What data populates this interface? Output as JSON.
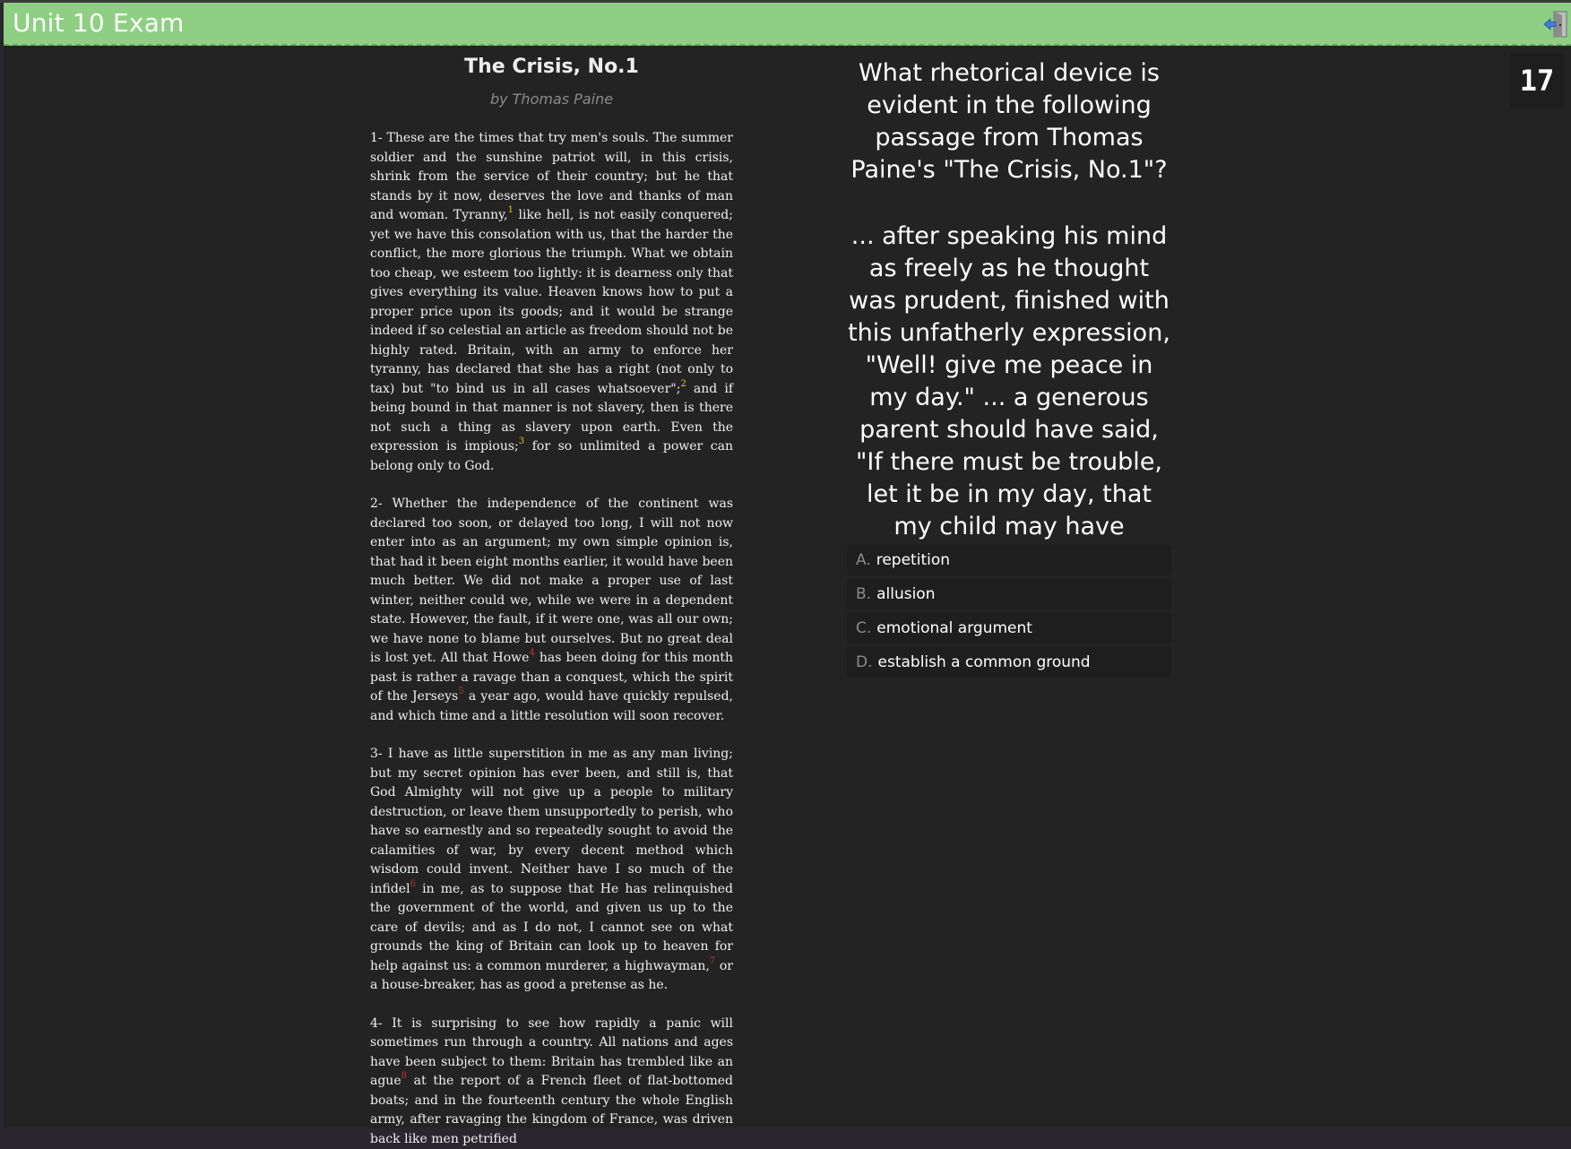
{
  "header": {
    "title": "Unit 10 Exam",
    "exit_icon": "exit-door-icon"
  },
  "counter": "17",
  "passage": {
    "title": "The Crisis, No.1",
    "author": "by Thomas Paine",
    "paragraphs": [
      [
        {
          "t": "1- These are the times that try men's souls. The summer soldier and the sunshine patriot will, in this crisis, shrink from the service of their country; but he that stands by it now, deserves the love and thanks of man and woman. Tyranny,"
        },
        {
          "fn": "1",
          "c": "y"
        },
        {
          "t": " like hell, is not easily conquered; yet we have this consolation with us, that the harder the conflict, the more glorious the triumph. What we obtain too cheap, we esteem too lightly: it is dearness only that gives everything its value. Heaven knows how to put a proper price upon its goods; and it would be strange indeed if so celestial an article as freedom should not be highly rated. Britain, with an army to enforce her tyranny, has declared that she has a right (not only to tax) but \"to bind us in all cases whatsoever\";"
        },
        {
          "fn": "2",
          "c": "y"
        },
        {
          "t": " and if being bound in that manner is not slavery, then is there not such a thing as slavery upon earth. Even the expression is impious;"
        },
        {
          "fn": "3",
          "c": "y"
        },
        {
          "t": " for so unlimited a power can belong only to God."
        }
      ],
      [
        {
          "t": "2- Whether the independence of the continent was declared too soon, or delayed too long, I will not now enter into as an argument; my own simple opinion is, that had it been eight months earlier, it would have been much better. We did not make a proper use of last winter, neither could we, while we were in a dependent state. However, the fault, if it were one, was all our own; we have none to blame but ourselves. But no great deal is lost yet. All that Howe"
        },
        {
          "fn": "4",
          "c": "r"
        },
        {
          "t": " has been doing for this month past is rather a ravage than a conquest, which the spirit of the Jerseys"
        },
        {
          "fn": "5",
          "c": "r"
        },
        {
          "t": " a year ago, would have quickly repulsed, and which time and a little resolution will soon recover."
        }
      ],
      [
        {
          "t": "3- I have as little superstition in me as any man living; but my secret opinion has ever been, and still is, that God Almighty will not give up a people to military destruction, or leave them unsupportedly to perish, who have so earnestly and so repeatedly sought to avoid the calamities of war, by every decent method which wisdom could invent. Neither have I so much of the infidel"
        },
        {
          "fn": "6",
          "c": "r"
        },
        {
          "t": " in me, as to suppose that He has relinquished the government of the world, and given us up to the care of devils; and as I do not, I cannot see on what grounds the king of Britain can look up to heaven for help against us: a common murderer, a highwayman,"
        },
        {
          "fn": "7",
          "c": "r"
        },
        {
          "t": " or a house-breaker, has as good a pretense as he."
        }
      ],
      [
        {
          "t": "4- It is surprising to see how rapidly a panic will sometimes run through a country. All nations and ages have been subject to them: Britain has trembled like an ague"
        },
        {
          "fn": "8",
          "c": "r"
        },
        {
          "t": " at the report of a French fleet of flat-bottomed boats; and in the fourteenth century the whole English army, after ravaging the kingdom of France, was driven back like men petrified"
        }
      ]
    ]
  },
  "question": {
    "text": "What rhetorical device is evident in the following passage from Thomas Paine's \"The Crisis, No.1\"?",
    "quote": "... after speaking his mind as freely as he thought was prudent, finished with this unfatherly expression, \"Well! give me peace in my day.\" ... a generous parent should have said, \"If there must be trouble, let it be in my day, that my child may have peace;\""
  },
  "answers": [
    {
      "letter": "A.",
      "text": "repetition"
    },
    {
      "letter": "B.",
      "text": "allusion"
    },
    {
      "letter": "C.",
      "text": "emotional argument"
    },
    {
      "letter": "D.",
      "text": "establish a common ground"
    }
  ]
}
